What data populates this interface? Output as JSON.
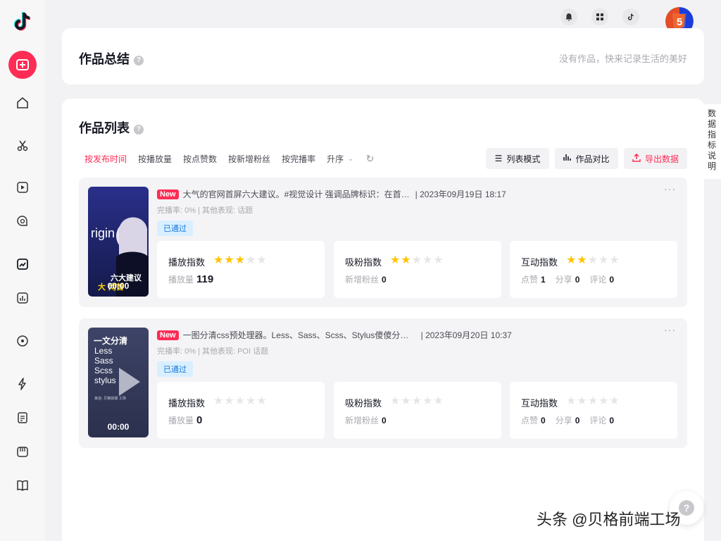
{
  "topbar": {
    "notify_label": "通知",
    "site_label": "网址",
    "douyin_label": "抖音"
  },
  "summary": {
    "title": "作品总结",
    "help": "?",
    "hint": "没有作品，快来记录生活的美好"
  },
  "list": {
    "title": "作品列表",
    "help": "?",
    "sort_options": [
      "按发布时间",
      "按播放量",
      "按点赞数",
      "按新增粉丝",
      "按完播率",
      "升序"
    ],
    "chevron": "⌄",
    "refresh": "↻",
    "list_mode_label": "列表模式",
    "compare_label": "作品对比",
    "export_label": "导出数据"
  },
  "items": [
    {
      "new_label": "New",
      "title": "大气的官网首屏六大建议。#视觉设计 强调品牌标识：在首…",
      "date": "| 2023年09月19日 18:17",
      "meta": "完播率: 0% | 其他表现: 话题",
      "status": "已通过",
      "duration": "00:00",
      "thumb_text_1": "rigin",
      "thumb_text_2": "六大建议",
      "thumb_text_3": "大 网首",
      "more": "···",
      "play_title": "播放指数",
      "play_sub": "播放量",
      "play_value": "119",
      "fans_title": "吸粉指数",
      "fans_sub": "新增粉丝",
      "fans_value": "0",
      "interact_title": "互动指数",
      "likes_label": "点赞",
      "likes_value": "1",
      "shares_label": "分享",
      "shares_value": "0",
      "comments_label": "评论",
      "comments_value": "0",
      "play_stars": 3,
      "fans_stars": 2,
      "interact_stars": 2
    },
    {
      "new_label": "New",
      "title": "一图分清css预处理器。Less、Sass、Scss、Stylus傻傻分不…",
      "date": "| 2023年09月20日 10:37",
      "meta": "完播率: 0% | 其他表现: POI 话题",
      "status": "已通过",
      "duration": "00:00",
      "thumb_text_1": "一文分清",
      "thumb_text_2": "Less",
      "thumb_text_3": "Sass",
      "thumb_text_4": "Scss",
      "thumb_text_5": "stylus",
      "thumb_text_6": "来自: 贝格前端 工场",
      "more": "···",
      "play_title": "播放指数",
      "play_sub": "播放量",
      "play_value": "0",
      "fans_title": "吸粉指数",
      "fans_sub": "新增粉丝",
      "fans_value": "0",
      "interact_title": "互动指数",
      "likes_label": "点赞",
      "likes_value": "0",
      "shares_label": "分享",
      "shares_value": "0",
      "comments_label": "评论",
      "comments_value": "0",
      "play_stars": 0,
      "fans_stars": 0,
      "interact_stars": 0
    }
  ],
  "right_tab": "数据指标说明",
  "help_float": "?",
  "watermark": "头条 @贝格前端工场",
  "avatar_text": "5",
  "colors": {
    "accent": "#fe2c55",
    "star": "#ffc300",
    "pass": "#1777d9"
  }
}
